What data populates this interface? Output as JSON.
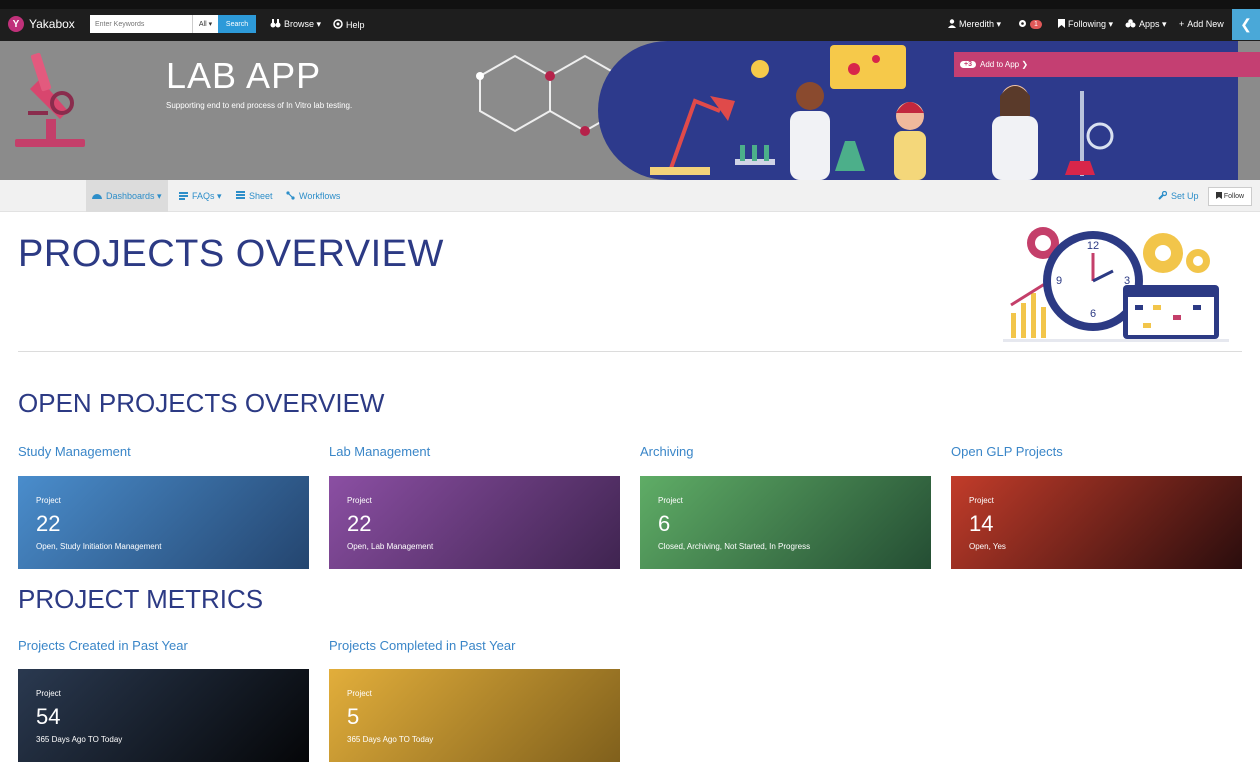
{
  "colors": {
    "topbar": "#1e1e1e",
    "brand": "#c0317a",
    "accent_link": "#2d8ec9",
    "heading": "#2c3a84",
    "add_to_app": "#c43f72",
    "banner_bg": "#8b8b8b",
    "banner_art": "#2d3a8c"
  },
  "topbar": {
    "brand": "Yakabox",
    "search": {
      "placeholder": "Enter Keywords",
      "scope": "All ▾",
      "button": "Search"
    },
    "browse": "Browse ▾",
    "help": "Help",
    "user": "Meredith ▾",
    "notifications_count": "1",
    "following": "Following ▾",
    "apps": "Apps ▾",
    "add_new": "Add New"
  },
  "banner": {
    "title": "LAB APP",
    "subtitle": "Supporting end to end process of In Vitro lab testing.",
    "add_to_app": "Add to App ❯",
    "add_to_app_badge": "+3"
  },
  "subnav": {
    "items": [
      {
        "label": "Dashboards ▾",
        "icon": "dashboard-icon"
      },
      {
        "label": "FAQs ▾",
        "icon": "faq-icon"
      },
      {
        "label": "Sheet",
        "icon": "sheet-icon"
      },
      {
        "label": "Workflows",
        "icon": "workflow-icon"
      }
    ],
    "setup": "Set Up",
    "follow": "Follow"
  },
  "main": {
    "title": "PROJECTS OVERVIEW",
    "open_section": {
      "title": "OPEN PROJECTS OVERVIEW",
      "cards": [
        {
          "label": "Study Management",
          "kind": "Project",
          "value": "22",
          "desc": "Open, Study Initiation Management"
        },
        {
          "label": "Lab Management",
          "kind": "Project",
          "value": "22",
          "desc": "Open, Lab Management"
        },
        {
          "label": "Archiving",
          "kind": "Project",
          "value": "6",
          "desc": "Closed, Archiving, Not Started, In Progress"
        },
        {
          "label": "Open GLP Projects",
          "kind": "Project",
          "value": "14",
          "desc": "Open, Yes"
        }
      ]
    },
    "metrics_section": {
      "title": "PROJECT METRICS",
      "cards": [
        {
          "label": "Projects Created in Past Year",
          "kind": "Project",
          "value": "54",
          "desc": "365 Days Ago TO Today"
        },
        {
          "label": "Projects Completed in Past Year",
          "kind": "Project",
          "value": "5",
          "desc": "365 Days Ago TO Today"
        }
      ]
    },
    "clock_numbers": [
      "12",
      "3",
      "6",
      "9"
    ]
  }
}
